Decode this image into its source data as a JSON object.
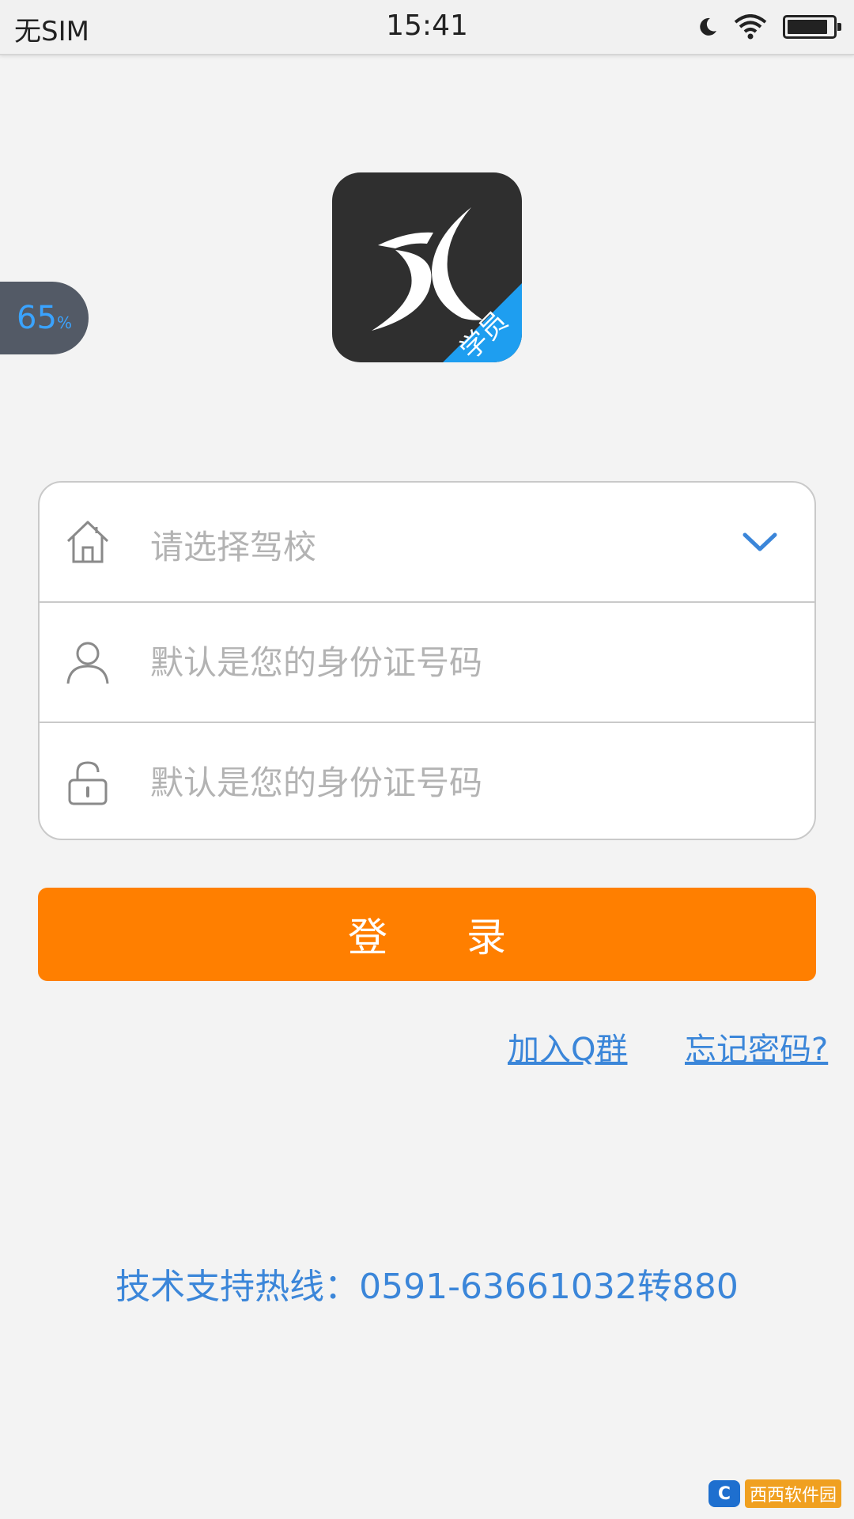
{
  "status_bar": {
    "carrier": "无SIM",
    "time": "15:41",
    "icons": [
      "moon-icon",
      "wifi-icon",
      "battery-icon"
    ],
    "battery_level": 0.9
  },
  "float_badge": {
    "value": "65",
    "unit": "%"
  },
  "logo": {
    "icon": "app-logo-icon",
    "ribbon_text": "学员",
    "ribbon_color": "#1e9ef0"
  },
  "form": {
    "school_placeholder": "请选择驾校",
    "id_placeholder": "默认是您的身份证号码",
    "password_placeholder": "默认是您的身份证号码"
  },
  "login_button": {
    "label": "登录"
  },
  "links": {
    "join_qq": "加入Q群",
    "forgot_password": "忘记密码?"
  },
  "hotline": "技术支持热线：0591-63661032转880",
  "watermark": {
    "badge_text": "C",
    "text": "西西软件园"
  },
  "colors": {
    "accent": "#ff7f00",
    "link": "#3b86d9",
    "background": "#f3f3f3"
  }
}
